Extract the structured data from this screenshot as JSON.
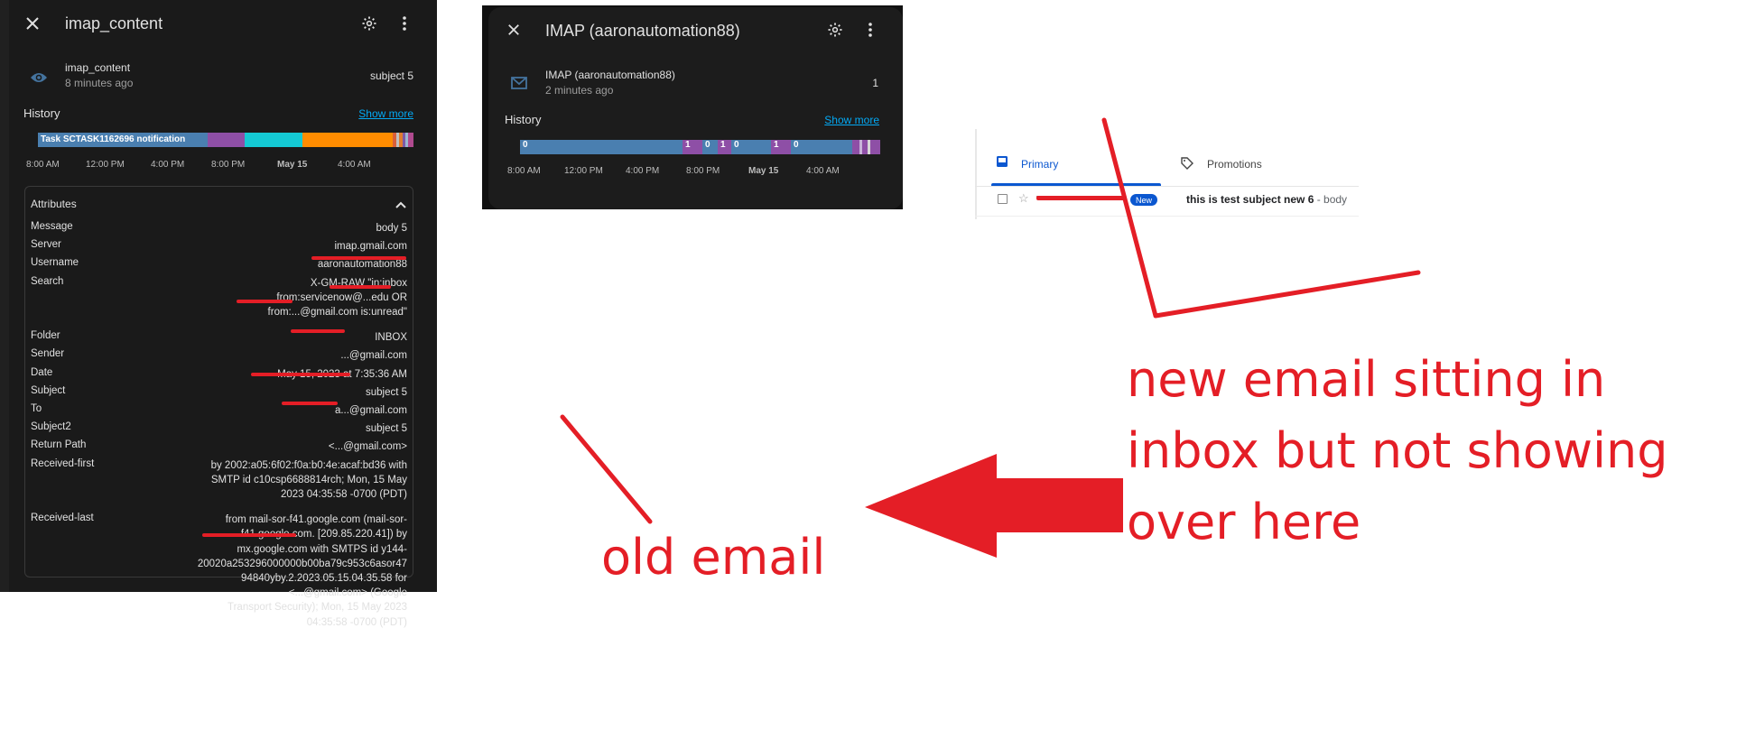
{
  "left_panel": {
    "title": "imap_content",
    "entity_name": "imap_content",
    "entity_time": "8 minutes ago",
    "entity_state": "subject 5",
    "history_title": "History",
    "show_more": "Show more",
    "timeline_label": "Task SCTASK1162696 notification",
    "ticks": [
      "8:00 AM",
      "12:00 PM",
      "4:00 PM",
      "8:00 PM",
      "May 15",
      "4:00 AM"
    ],
    "attributes_title": "Attributes",
    "attributes": [
      {
        "key": "Message",
        "lines": [
          "body 5"
        ]
      },
      {
        "key": "Server",
        "lines": [
          "imap.gmail.com"
        ]
      },
      {
        "key": "Username",
        "lines": [
          "aaronautomation88"
        ]
      },
      {
        "key": "Search",
        "lines": [
          "X-GM-RAW \"in:inbox",
          "from:servicenow@...edu OR",
          "from:...@gmail.com is:unread\""
        ]
      },
      {
        "key": "Folder",
        "lines": [
          "INBOX"
        ]
      },
      {
        "key": "Sender",
        "lines": [
          "...@gmail.com"
        ]
      },
      {
        "key": "Date",
        "lines": [
          "May 15, 2023 at 7:35:36 AM"
        ]
      },
      {
        "key": "Subject",
        "lines": [
          "subject 5"
        ]
      },
      {
        "key": "To",
        "lines": [
          "a...@gmail.com"
        ]
      },
      {
        "key": "Subject2",
        "lines": [
          "subject 5"
        ]
      },
      {
        "key": "Return Path",
        "lines": [
          "<...@gmail.com>"
        ]
      },
      {
        "key": "Received-first",
        "lines": [
          "by 2002:a05:6f02:f0a:b0:4e:acaf:bd36 with",
          "SMTP id c10csp6688814rch; Mon, 15 May",
          "2023 04:35:58 -0700 (PDT)"
        ]
      },
      {
        "key": "Received-last",
        "lines": [
          "from mail-sor-f41.google.com (mail-sor-",
          "f41.google.com. [209.85.220.41]) by",
          "mx.google.com with SMTPS id y144-",
          "20020a253296000000b00ba79c953c6asor47",
          "94840yby.2.2023.05.15.04.35.58 for",
          "<...@gmail.com> (Google",
          "Transport Security); Mon, 15 May 2023",
          "04:35:58 -0700 (PDT)"
        ]
      }
    ]
  },
  "middle_panel": {
    "title": "IMAP (aaronautomation88)",
    "entity_name": "IMAP (aaronautomation88)",
    "entity_time": "2 minutes ago",
    "entity_state": "1",
    "history_title": "History",
    "show_more": "Show more",
    "segment_labels": [
      "0",
      "1",
      "0",
      "1",
      "0",
      "1",
      "0"
    ],
    "ticks": [
      "8:00 AM",
      "12:00 PM",
      "4:00 PM",
      "8:00 PM",
      "May 15",
      "4:00 AM"
    ]
  },
  "gmail": {
    "tab_primary": "Primary",
    "tab_promotions": "Promotions",
    "badge_new": "New",
    "subject": "this is test subject new 6",
    "snippet": " - body"
  },
  "annotations": {
    "new_email": [
      "new email sitting in",
      "inbox but not showing",
      "over here"
    ],
    "old_email": "old email"
  },
  "colors": {
    "annotation_red": "#e41e26",
    "timeline_blue": "#4a7fb0",
    "timeline_purple": "#8e4fa6",
    "timeline_cyan": "#14c9d4",
    "timeline_orange": "#ff8c00",
    "link_blue": "#03a9f4",
    "gmail_blue": "#0b57d0"
  }
}
